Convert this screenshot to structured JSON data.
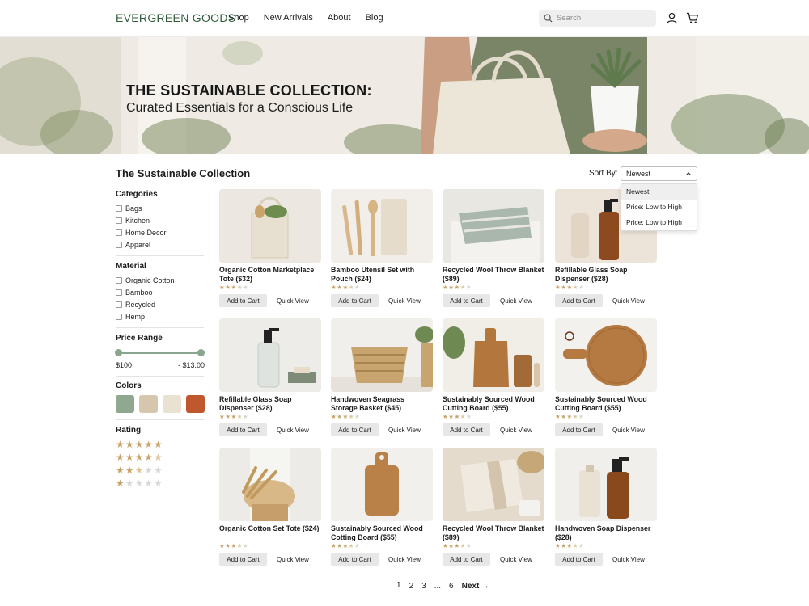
{
  "header": {
    "logo": "EVERGREEN GOODS",
    "nav": [
      "Shop",
      "New Arrivals",
      "About",
      "Blog"
    ],
    "search_placeholder": "Search"
  },
  "hero": {
    "title": "THE SUSTAINABLE COLLECTION:",
    "subtitle": "Curated Essentials for a Conscious Life"
  },
  "collection": {
    "title": "The Sustainable Collection",
    "sort_label": "Sort By:",
    "sort_selected": "Newest",
    "sort_options": [
      "Newest",
      "Price: Low to High",
      "Price: Low to High"
    ]
  },
  "filters": {
    "categories_heading": "Categories",
    "categories": [
      "Bags",
      "Kitchen",
      "Home Decor",
      "Apparel"
    ],
    "material_heading": "Material",
    "materials": [
      "Organic Cotton",
      "Bamboo",
      "Recycled",
      "Hemp"
    ],
    "price_heading": "Price Range",
    "price_min": "$100",
    "price_max": "- $13.00",
    "colors_heading": "Colors",
    "colors": [
      "#8fa88f",
      "#d7c6ae",
      "#e9e2d3",
      "#c0582e"
    ],
    "rating_heading": "Rating",
    "ratings": [
      5,
      4.5,
      2.5,
      1
    ]
  },
  "products": [
    {
      "title": "Organic Cotton Marketplace Tote ($32)",
      "rating": 3.5
    },
    {
      "title": "Bamboo Utensil Set with Pouch ($24)",
      "rating": 3.5
    },
    {
      "title": "Recycled Wool Throw Blanket ($89)",
      "rating": 3.5
    },
    {
      "title": "Refillable Glass Soap Dispenser ($28)",
      "rating": 3.5
    },
    {
      "title": "Refillable Glass Soap Dispenser ($28)",
      "rating": 3.5
    },
    {
      "title": "Handwoven Seagrass Storage Basket ($45)",
      "rating": 3.5
    },
    {
      "title": "Sustainably Sourced Wood Cutting Board ($55)",
      "rating": 3.5
    },
    {
      "title": "Sustainably Sourced Wood Cutting Board ($55)",
      "rating": 3.5
    },
    {
      "title": "Organic Cotton Set Tote ($24)",
      "rating": 3.5
    },
    {
      "title": "Sustainably Sourced Wood Cotting Board ($55)",
      "rating": 3.5
    },
    {
      "title": "Recycled Wool Throw Blanket ($89)",
      "rating": 3.5
    },
    {
      "title": "Handwoven Soap Dispenser ($28)",
      "rating": 3.5
    }
  ],
  "product_actions": {
    "add_to_cart": "Add to Cart",
    "quick_view": "Quick View"
  },
  "pagination": {
    "pages": [
      "1",
      "2",
      "3",
      "...",
      "6"
    ],
    "current": "1",
    "next": "Next →"
  }
}
